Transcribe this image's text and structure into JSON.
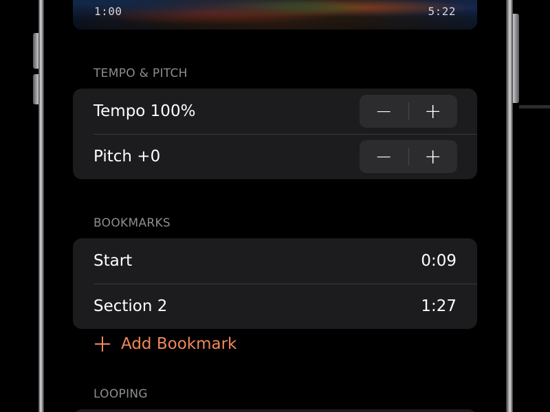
{
  "player": {
    "elapsed": "1:00",
    "total": "5:22"
  },
  "tempo_pitch": {
    "header": "TEMPO & PITCH",
    "tempo_label": "Tempo 100%",
    "pitch_label": "Pitch +0",
    "minus_symbol": "−",
    "plus_symbol": "+"
  },
  "bookmarks": {
    "header": "BOOKMARKS",
    "items": [
      {
        "label": "Start",
        "time": "0:09"
      },
      {
        "label": "Section 2",
        "time": "1:27"
      }
    ],
    "add_label": "Add Bookmark"
  },
  "looping": {
    "header": "LOOPING"
  },
  "colors": {
    "accent": "#f0885c",
    "background": "#000000",
    "group_bg": "#1c1c1e",
    "secondary_text": "#8e8e93"
  }
}
